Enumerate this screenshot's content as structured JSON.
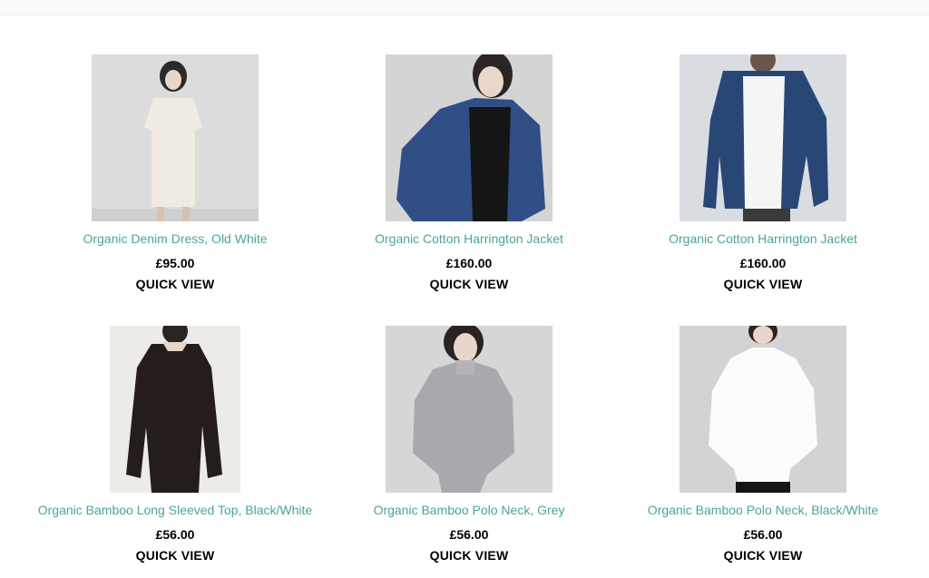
{
  "products": [
    {
      "name": "Organic Denim Dress, Old White",
      "price": "£95.00",
      "action": "QUICK VIEW"
    },
    {
      "name": "Organic Cotton Harrington Jacket",
      "price": "£160.00",
      "action": "QUICK VIEW"
    },
    {
      "name": "Organic Cotton Harrington Jacket",
      "price": "£160.00",
      "action": "QUICK VIEW"
    },
    {
      "name": "Organic Bamboo Long Sleeved Top, Black/White",
      "price": "£56.00",
      "action": "QUICK VIEW"
    },
    {
      "name": "Organic Bamboo Polo Neck, Grey",
      "price": "£56.00",
      "action": "QUICK VIEW"
    },
    {
      "name": "Organic Bamboo Polo Neck, Black/White",
      "price": "£56.00",
      "action": "QUICK VIEW"
    }
  ],
  "colors": {
    "title": "#4aa3a1",
    "price": "#000000",
    "background": "#ffffff"
  }
}
